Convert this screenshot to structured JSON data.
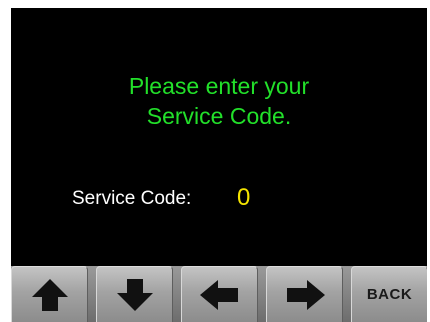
{
  "prompt": {
    "line1": "Please enter your",
    "line2": "Service Code."
  },
  "service_code": {
    "label": "Service Code:",
    "value": "0"
  },
  "toolbar": {
    "keys": [
      {
        "icon": "arrow-up-icon"
      },
      {
        "icon": "arrow-down-icon"
      },
      {
        "icon": "arrow-left-icon"
      },
      {
        "icon": "arrow-right-icon"
      },
      {
        "label": "BACK"
      }
    ]
  },
  "colors": {
    "prompt": "#22e02a",
    "label": "#ffffff",
    "value": "#f5e400",
    "screen": "#000000"
  }
}
